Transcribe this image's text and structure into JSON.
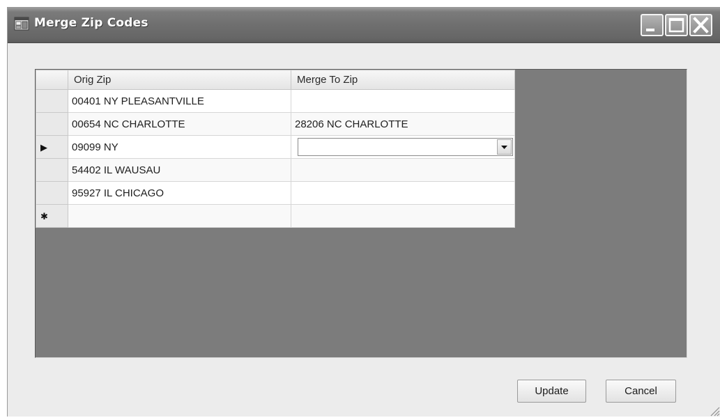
{
  "window": {
    "title": "Merge Zip Codes"
  },
  "icons": {
    "app": "app-icon",
    "minimize": "minimize-icon",
    "maximize": "maximize-icon",
    "close": "close-icon",
    "current_row": "current-row-arrow-icon",
    "new_row": "new-row-asterisk-icon",
    "dropdown": "chevron-down-icon"
  },
  "grid": {
    "columns": [
      "Orig Zip",
      "Merge To Zip"
    ],
    "row_indicators": {
      "current": "▶",
      "new": "✱"
    },
    "rows": [
      {
        "orig_zip": "00401 NY PLEASANTVILLE",
        "merge_to_zip": ""
      },
      {
        "orig_zip": "00654 NC CHARLOTTE",
        "merge_to_zip": "28206 NC CHARLOTTE"
      },
      {
        "orig_zip": "09099 NY",
        "merge_to_zip": ""
      },
      {
        "orig_zip": "54402 IL WAUSAU",
        "merge_to_zip": ""
      },
      {
        "orig_zip": "95927 IL CHICAGO",
        "merge_to_zip": ""
      }
    ],
    "current_row_index": 2
  },
  "buttons": {
    "update": "Update",
    "cancel": "Cancel"
  },
  "colors": {
    "titlebar": "#6f6f6f",
    "window_bg": "#ececec",
    "grid_background": "#7c7c7c"
  }
}
